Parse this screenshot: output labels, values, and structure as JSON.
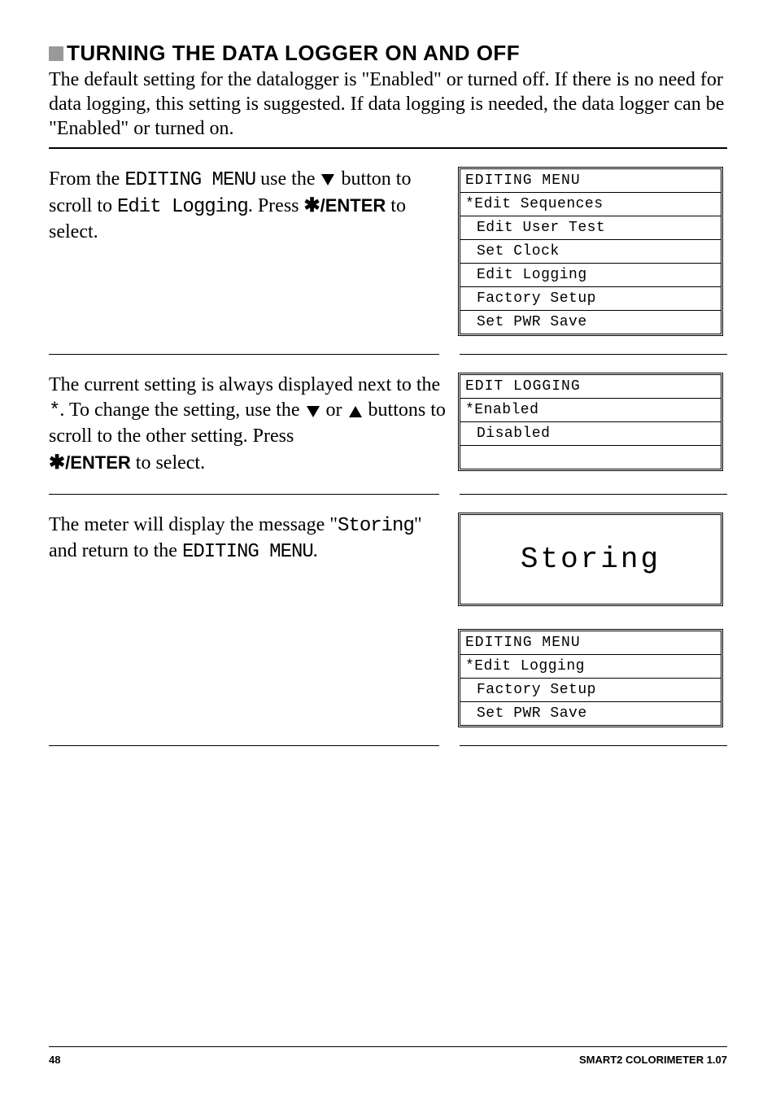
{
  "title": "TURNING THE DATA LOGGER ON AND OFF",
  "intro": "The default setting for the datalogger is \"Enabled\" or turned off. If there is no need for data logging, this setting is suggested. If data logging is needed, the data logger can be \"Enabled\" or turned on.",
  "step1": {
    "text_prefix": "From the ",
    "mono1": "EDITING MENU",
    "text_mid1": " use the ",
    "text_mid2": " button to scroll to ",
    "mono2": "Edit Logging",
    "text_mid3": ". Press ",
    "key": "/ENTER",
    "text_end": " to select.",
    "lcd": {
      "header": "EDITING MENU",
      "selected": "*Edit Sequences",
      "items": [
        "Edit User Test",
        "Set Clock",
        "Edit Logging",
        "Factory Setup",
        "Set PWR Save"
      ]
    }
  },
  "step2": {
    "text1": "The current setting is always displayed next to the ",
    "mono_star": "*",
    "text2": ". To change the setting, use the ",
    "text3": " or ",
    "text4": " buttons to scroll to the other setting. Press ",
    "key": "/ENTER",
    "text5": " to select.",
    "lcd": {
      "header": "EDIT LOGGING",
      "selected": "*Enabled",
      "items": [
        "Disabled"
      ]
    }
  },
  "step3": {
    "text1": "The meter will display the message \"",
    "mono1": "Storing",
    "text2": "\" and return to the ",
    "mono2": "EDITING MENU",
    "text3": ".",
    "storing": "Storing",
    "lcd": {
      "header": "EDITING MENU",
      "selected": "*Edit Logging",
      "items": [
        "Factory Setup",
        "Set PWR Save"
      ]
    }
  },
  "footer": {
    "page": "48",
    "product": "SMART2 COLORIMETER  1.07"
  }
}
